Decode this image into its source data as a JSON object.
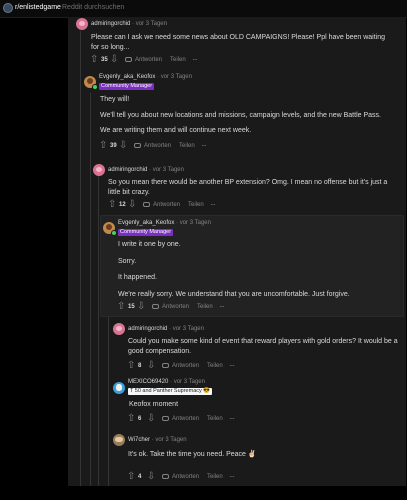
{
  "topbar": {
    "subreddit": "r/enlistedgame",
    "search_placeholder": "Reddit durchsuchen"
  },
  "actions": {
    "reply": "Antworten",
    "share": "Teilen",
    "more": "···",
    "sep": "·"
  },
  "comments": [
    {
      "author": "admiringorchid",
      "time": "vor 3 Tagen",
      "body": [
        "Please can I ask we need some news about OLD CAMPAIGNS! Please! Ppl have been waiting for so long..."
      ],
      "score": "35"
    },
    {
      "author": "Evgenly_aka_Keofox",
      "time": "vor 3 Tagen",
      "flair": "Community Manager",
      "body": [
        "They will!",
        "We'll tell you about new locations and missions, campaign levels, and the new Battle Pass.",
        "We are writing them and will continue next week."
      ],
      "score": "39"
    },
    {
      "author": "admiringorchid",
      "time": "vor 3 Tagen",
      "body": [
        "So you mean there would be another BP extension? Omg. I mean no offense but it's just a little bit crazy."
      ],
      "score": "12"
    },
    {
      "author": "Evgenly_aka_Keofox",
      "time": "vor 3 Tagen",
      "flair": "Community Manager",
      "body": [
        "I write it one by one.",
        "Sorry.",
        "It happened.",
        "We're really sorry. We understand that you are uncomfortable. Just forgive."
      ],
      "score": "15"
    },
    {
      "author": "admiringorchid",
      "time": "vor 3 Tagen",
      "body": [
        "Could you make some kind of event that reward players with gold orders? It would be a good compensation."
      ],
      "score": "8"
    },
    {
      "author": "MEXICO69420",
      "time": "vor 3 Tagen",
      "flair": "T 50 and Panther Supremacy 😎",
      "body": [
        "Keofox moment"
      ],
      "score": "6"
    },
    {
      "author": "Wi7cher",
      "time": "vor 3 Tagen",
      "body": [
        "It's ok. Take the time you need. Peace ✌🏻"
      ],
      "score": "4"
    }
  ]
}
